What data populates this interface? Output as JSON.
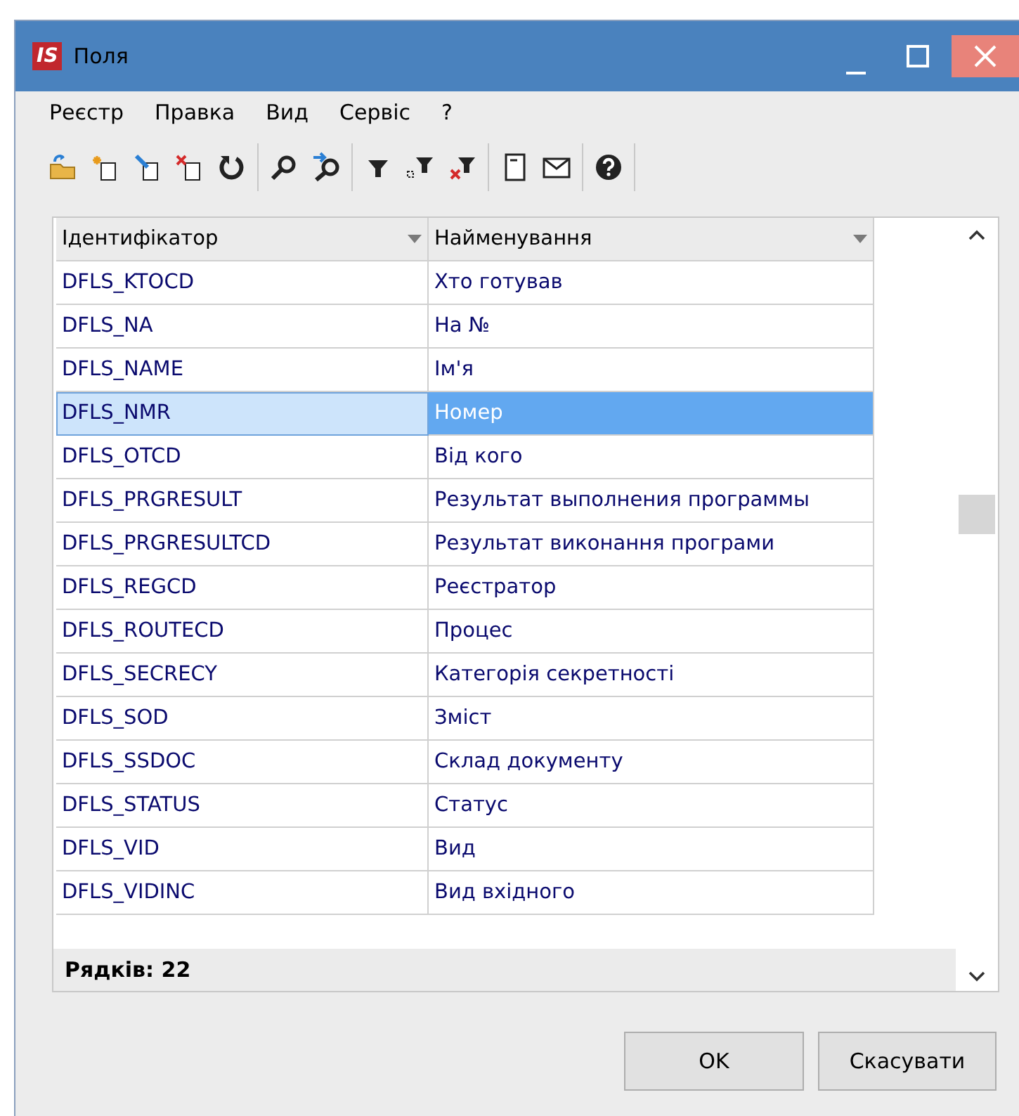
{
  "window": {
    "title": "Поля",
    "logo": "IS"
  },
  "menu": [
    "Реєстр",
    "Правка",
    "Вид",
    "Сервіс",
    "?"
  ],
  "toolbar": [
    [
      {
        "kind": "open"
      },
      {
        "kind": "new"
      },
      {
        "kind": "edit"
      },
      {
        "kind": "delete"
      },
      {
        "kind": "refresh"
      }
    ],
    [
      {
        "kind": "search"
      },
      {
        "kind": "search-next"
      }
    ],
    [
      {
        "kind": "filter"
      },
      {
        "kind": "filter-select"
      },
      {
        "kind": "filter-clear"
      }
    ],
    [
      {
        "kind": "note"
      },
      {
        "kind": "mail"
      }
    ],
    [
      {
        "kind": "help"
      }
    ]
  ],
  "table": {
    "columns": [
      "Ідентифікатор",
      "Найменування"
    ],
    "rows": [
      {
        "id": "DFLS_KTOCD",
        "name": "Хто готував",
        "selected": false
      },
      {
        "id": "DFLS_NA",
        "name": "На №",
        "selected": false
      },
      {
        "id": "DFLS_NAME",
        "name": "Ім'я",
        "selected": false
      },
      {
        "id": "DFLS_NMR",
        "name": "Номер",
        "selected": true
      },
      {
        "id": "DFLS_OTCD",
        "name": "Від кого",
        "selected": false
      },
      {
        "id": "DFLS_PRGRESULT",
        "name": "Результат выполнения программы",
        "selected": false
      },
      {
        "id": "DFLS_PRGRESULTCD",
        "name": "Результат виконання програми",
        "selected": false
      },
      {
        "id": "DFLS_REGCD",
        "name": "Реєстратор",
        "selected": false
      },
      {
        "id": "DFLS_ROUTECD",
        "name": "Процес",
        "selected": false
      },
      {
        "id": "DFLS_SECRECY",
        "name": "Категорія секретності",
        "selected": false
      },
      {
        "id": "DFLS_SOD",
        "name": "Зміст",
        "selected": false
      },
      {
        "id": "DFLS_SSDOC",
        "name": "Склад документу",
        "selected": false
      },
      {
        "id": "DFLS_STATUS",
        "name": "Статус",
        "selected": false
      },
      {
        "id": "DFLS_VID",
        "name": "Вид",
        "selected": false
      },
      {
        "id": "DFLS_VIDINC",
        "name": "Вид вхідного",
        "selected": false
      }
    ],
    "footer": "Рядків: 22"
  },
  "buttons": [
    "OK",
    "Скасувати"
  ]
}
